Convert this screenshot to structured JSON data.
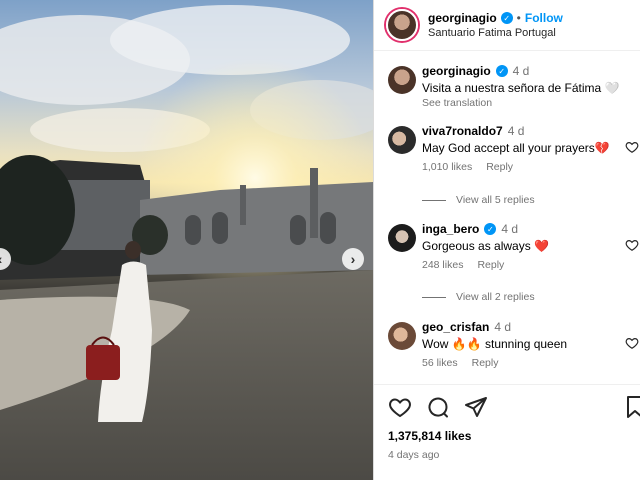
{
  "post": {
    "username": "georginagio",
    "follow_label": "Follow",
    "separator": "•",
    "location": "Santuario Fatima Portugal"
  },
  "caption": {
    "username": "georginagio",
    "time": "4 d",
    "text": "Visita a nuestra señora de Fátima 🤍",
    "see_translation": "See translation"
  },
  "comments": [
    {
      "username": "viva7ronaldo7",
      "time": "4 d",
      "text": "May God accept all your prayers💔",
      "likes": "1,010 likes",
      "reply": "Reply",
      "verified": false
    },
    {
      "username": "inga_bero",
      "time": "4 d",
      "text": "Gorgeous as always ❤️",
      "likes": "248 likes",
      "reply": "Reply",
      "verified": true
    },
    {
      "username": "geo_crisfan",
      "time": "4 d",
      "text": "Wow 🔥🔥 stunning queen",
      "likes": "56 likes",
      "reply": "Reply",
      "verified": false
    }
  ],
  "view_replies": [
    "View all 5 replies",
    "View all 2 replies"
  ],
  "footer": {
    "likes": "1,375,814 likes",
    "ago": "4 days ago"
  },
  "icons": {
    "verified": "✓",
    "prev_arrow": "‹",
    "next_arrow": "›"
  },
  "colors": {
    "accent": "#0095f6",
    "muted": "#737373"
  }
}
